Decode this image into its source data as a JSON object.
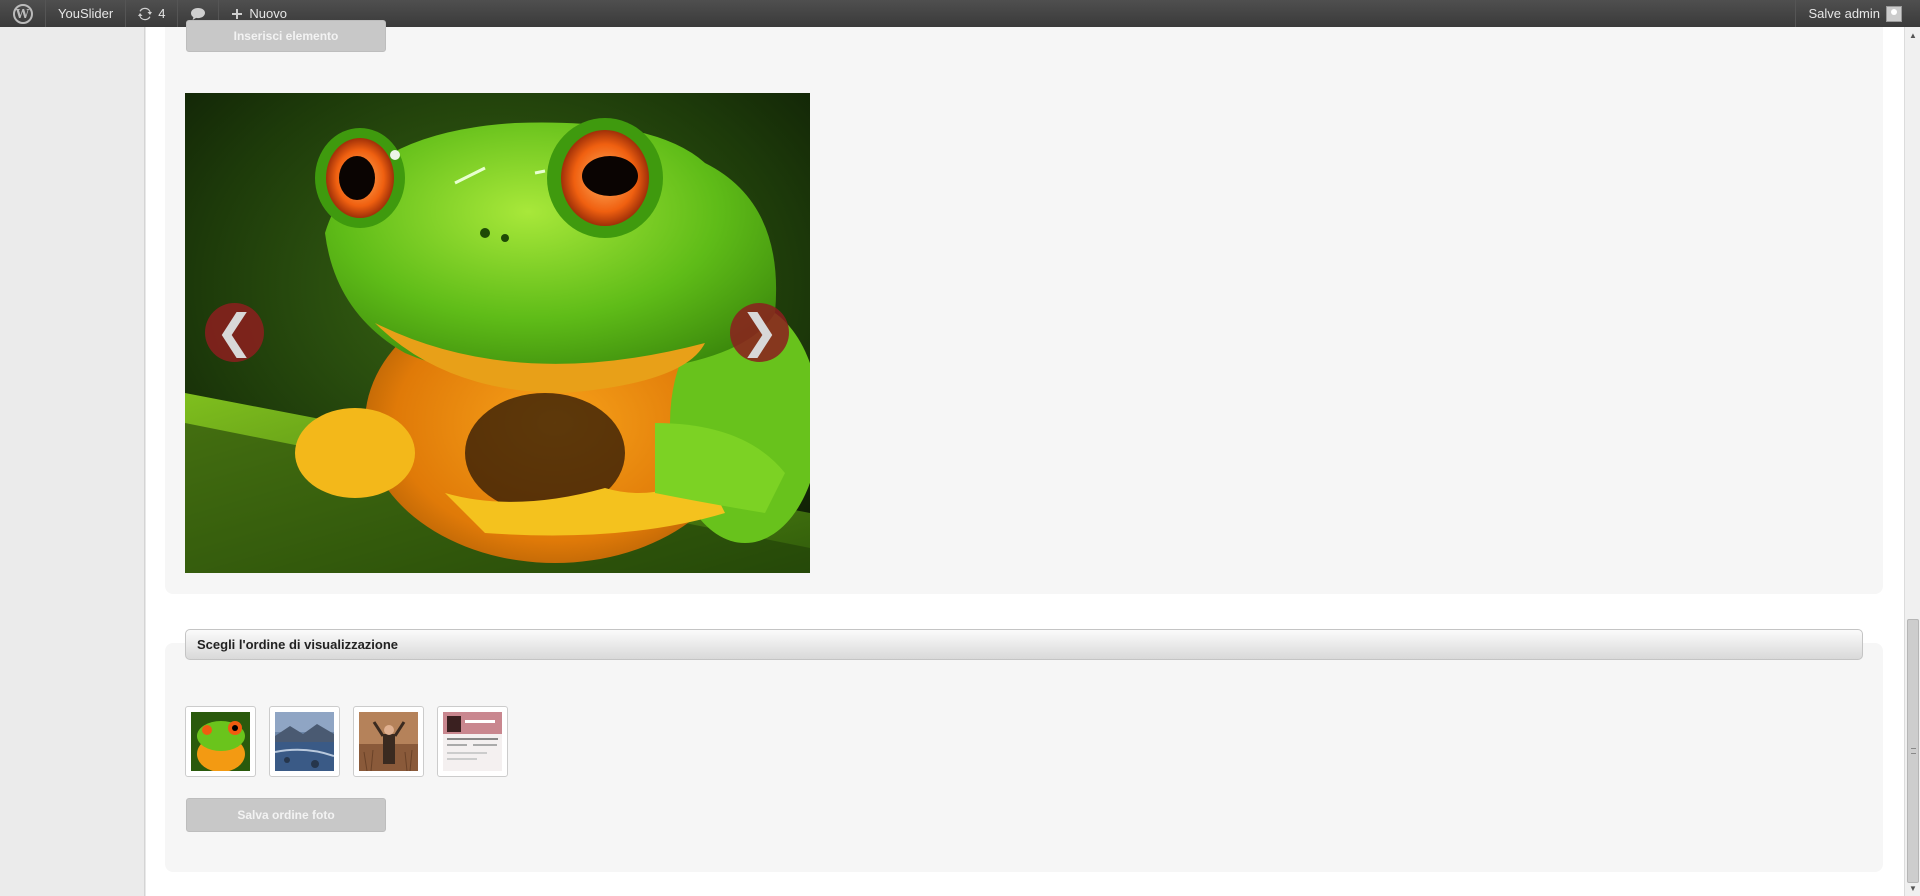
{
  "admin_bar": {
    "site_name": "YouSlider",
    "updates_count": "4",
    "new_label": "Nuovo",
    "greeting": "Salve admin"
  },
  "buttons": {
    "insert_label": "Inserisci elemento",
    "save_order_label": "Salva ordine foto"
  },
  "slider": {
    "prev_glyph": "❮",
    "next_glyph": "❯",
    "arrow_color": "#8c1e1e",
    "image": "green tree frog with red eyes"
  },
  "order_section": {
    "title": "Scegli l'ordine di visualizzazione",
    "thumbnails": [
      {
        "image": "frog"
      },
      {
        "image": "mountain lake"
      },
      {
        "image": "person in field"
      },
      {
        "image": "website screenshot"
      }
    ]
  },
  "colors": {
    "admin_bar_bg": "#464646",
    "panel_bg": "#f6f6f6",
    "button_disabled_bg": "#c8c8c8"
  }
}
